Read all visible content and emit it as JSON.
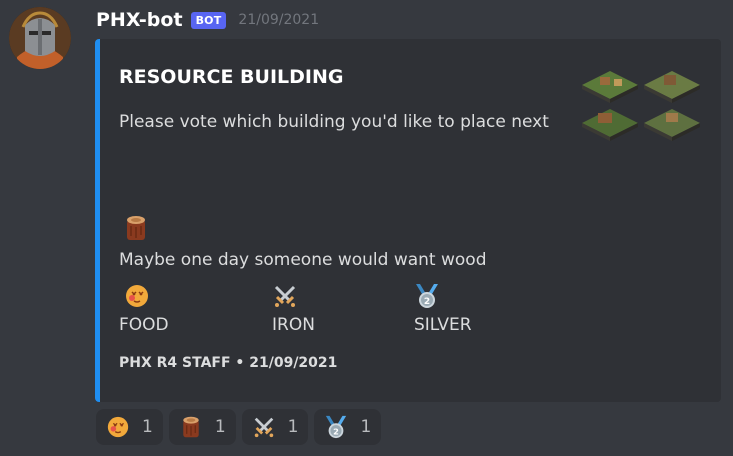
{
  "message": {
    "username": "PHX-bot",
    "bot_tag": "BOT",
    "timestamp": "21/09/2021"
  },
  "embed": {
    "accent_color": "#1f8ef1",
    "title": "RESOURCE BUILDING",
    "description": "Please vote which building you'd like to place next",
    "wood_text": "Maybe one day someone would want wood",
    "fields": [
      {
        "icon": "food-emoji-icon",
        "label": "FOOD"
      },
      {
        "icon": "crossed-swords-icon",
        "label": "IRON"
      },
      {
        "icon": "silver-medal-icon",
        "label": "SILVER"
      }
    ],
    "footer": "PHX R4 STAFF • 21/09/2021"
  },
  "reactions": [
    {
      "icon": "food-emoji-icon",
      "count": "1"
    },
    {
      "icon": "wood-log-icon",
      "count": "1"
    },
    {
      "icon": "crossed-swords-icon",
      "count": "1"
    },
    {
      "icon": "silver-medal-icon",
      "count": "1"
    }
  ]
}
